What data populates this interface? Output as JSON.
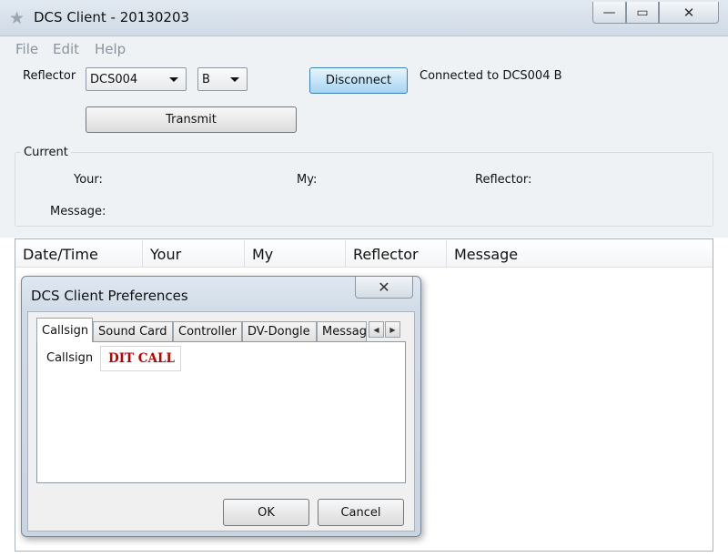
{
  "window": {
    "title": "DCS Client - 20130203",
    "min_symbol": "—",
    "max_symbol": "▭",
    "close_symbol": "✕",
    "app_icon": "star-icon"
  },
  "menu": [
    "File",
    "Edit",
    "Help"
  ],
  "controls": {
    "reflector_label": "Reflector",
    "reflector_value": "DCS004",
    "module_value": "B",
    "disconnect_label": "Disconnect",
    "status_text": "Connected to DCS004 B",
    "transmit_label": "Transmit"
  },
  "current": {
    "legend": "Current",
    "your_label": "Your:",
    "my_label": "My:",
    "reflector_label": "Reflector:",
    "message_label": "Message:"
  },
  "list_columns": [
    "Date/Time",
    "Your",
    "My",
    "Reflector",
    "Message"
  ],
  "dialog": {
    "title": "DCS Client Preferences",
    "close_symbol": "✕",
    "tabs": [
      "Callsign",
      "Sound Card",
      "Controller",
      "DV-Dongle",
      "Messag"
    ],
    "callsign_label": "Callsign",
    "callsign_value": "DIT CALL",
    "ok_label": "OK",
    "cancel_label": "Cancel"
  },
  "colors": {
    "callsign_text": "#c00000",
    "disconnect_button": "#a6d4f2"
  }
}
